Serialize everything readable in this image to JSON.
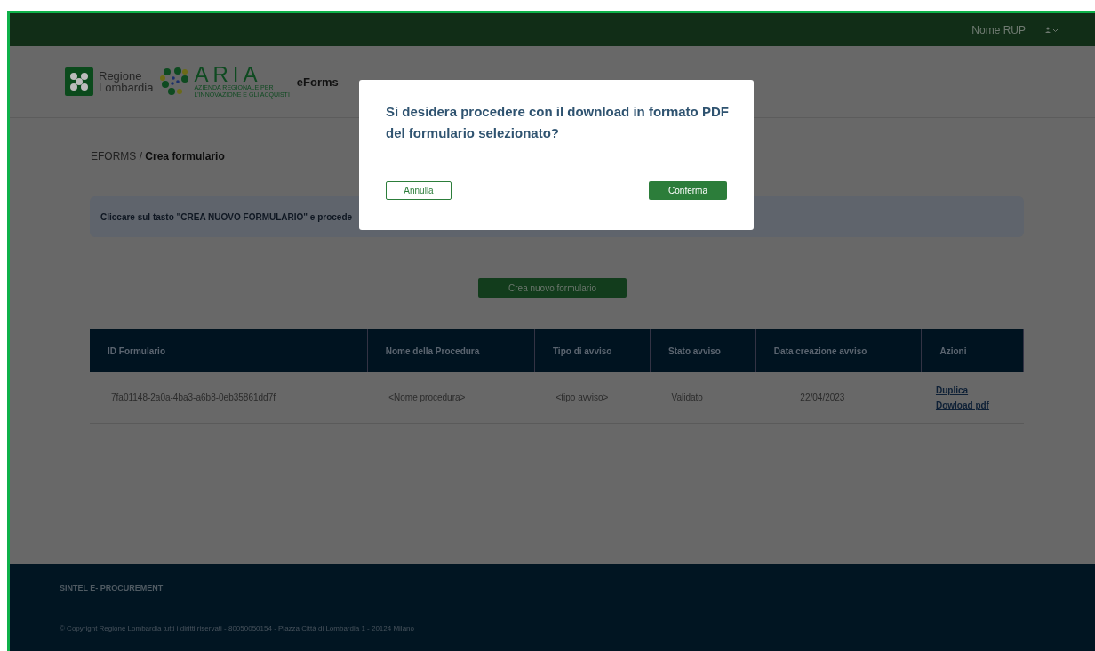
{
  "top_bar": {
    "user_name": "Nome RUP"
  },
  "header": {
    "logo_text": [
      "Regione",
      "Lombardia"
    ],
    "aria_logo": "ARIA",
    "aria_subtitle": [
      "AZIENDA REGIONALE PER",
      "L'INNOVAZIONE E GLI ACQUISTI"
    ],
    "app_title": "eForms"
  },
  "breadcrumb": {
    "root": "EFORMS",
    "separator": " / ",
    "current": "Crea formulario"
  },
  "info_box": {
    "text": "Cliccare sul tasto \"CREA NUOVO FORMULARIO\" e procede"
  },
  "create_button": "Crea nuovo formulario",
  "table": {
    "columns": [
      "ID Formulario",
      "Nome della Procedura",
      "Tipo di avviso",
      "Stato avviso",
      "Data creazione avviso",
      "Azioni"
    ],
    "rows": [
      {
        "id": "7fa01148-2a0a-4ba3-a6b8-0eb35861dd7f",
        "procedure": "<Nome procedura>",
        "type": "<tipo avviso>",
        "status": "Validato",
        "date": "22/04/2023",
        "actions": [
          "Duplica",
          "Dowload pdf"
        ]
      }
    ]
  },
  "modal": {
    "message": "Si desidera procedere con il download in formato PDF del formulario selezionato?",
    "cancel": "Annulla",
    "confirm": "Conferma"
  },
  "footer": {
    "title": "SINTEL E- PROCUREMENT",
    "copyright": "© Copyright Regione Lombardia tutti i diritti riservati - 80050050154 - Piazza Città di Lombardia 1 - 20124 Milano"
  }
}
